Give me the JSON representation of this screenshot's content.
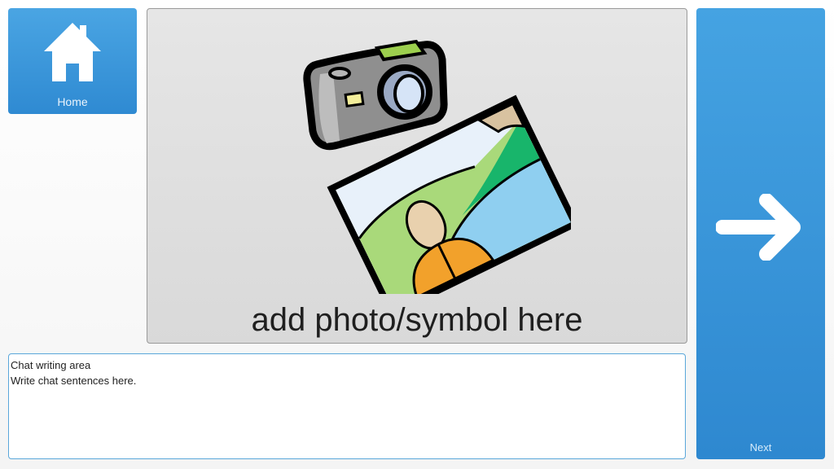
{
  "home": {
    "label": "Home",
    "icon": "house-icon"
  },
  "symbol_area": {
    "caption": "add photo/symbol here",
    "icon": "camera-photo-icon"
  },
  "chat": {
    "title": "Chat writing area",
    "placeholder_text": "Write chat sentences here."
  },
  "next": {
    "label": "Next",
    "icon": "arrow-right-icon"
  },
  "colors": {
    "button_blue": "#3a97da",
    "symbol_background": "#dedede",
    "chat_border": "#5aa7da"
  }
}
